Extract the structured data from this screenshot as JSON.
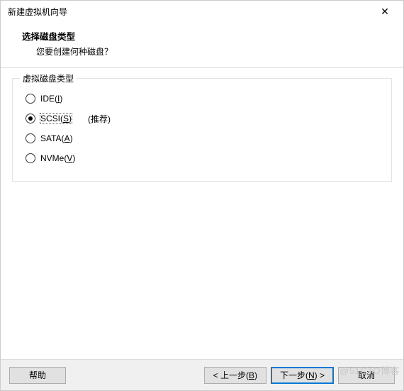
{
  "window": {
    "title": "新建虚拟机向导",
    "close_glyph": "✕"
  },
  "header": {
    "heading": "选择磁盘类型",
    "subheading": "您要创建何种磁盘？"
  },
  "group": {
    "title": "虚拟磁盘类型",
    "recommended_label": "(推荐)",
    "options": [
      {
        "label_pre": "IDE(",
        "mnemonic": "I",
        "label_post": ")",
        "checked": false,
        "recommended": false
      },
      {
        "label_pre": "SCSI(",
        "mnemonic": "S",
        "label_post": ")",
        "checked": true,
        "recommended": true
      },
      {
        "label_pre": "SATA(",
        "mnemonic": "A",
        "label_post": ")",
        "checked": false,
        "recommended": false
      },
      {
        "label_pre": "NVMe(",
        "mnemonic": "V",
        "label_post": ")",
        "checked": false,
        "recommended": false
      }
    ]
  },
  "footer": {
    "help": "帮助",
    "back_pre": "< 上一步(",
    "back_mn": "B",
    "back_post": ")",
    "next_pre": "下一步(",
    "next_mn": "N",
    "next_post": ") >",
    "cancel": "取消"
  },
  "watermark": "@51CTO博客"
}
